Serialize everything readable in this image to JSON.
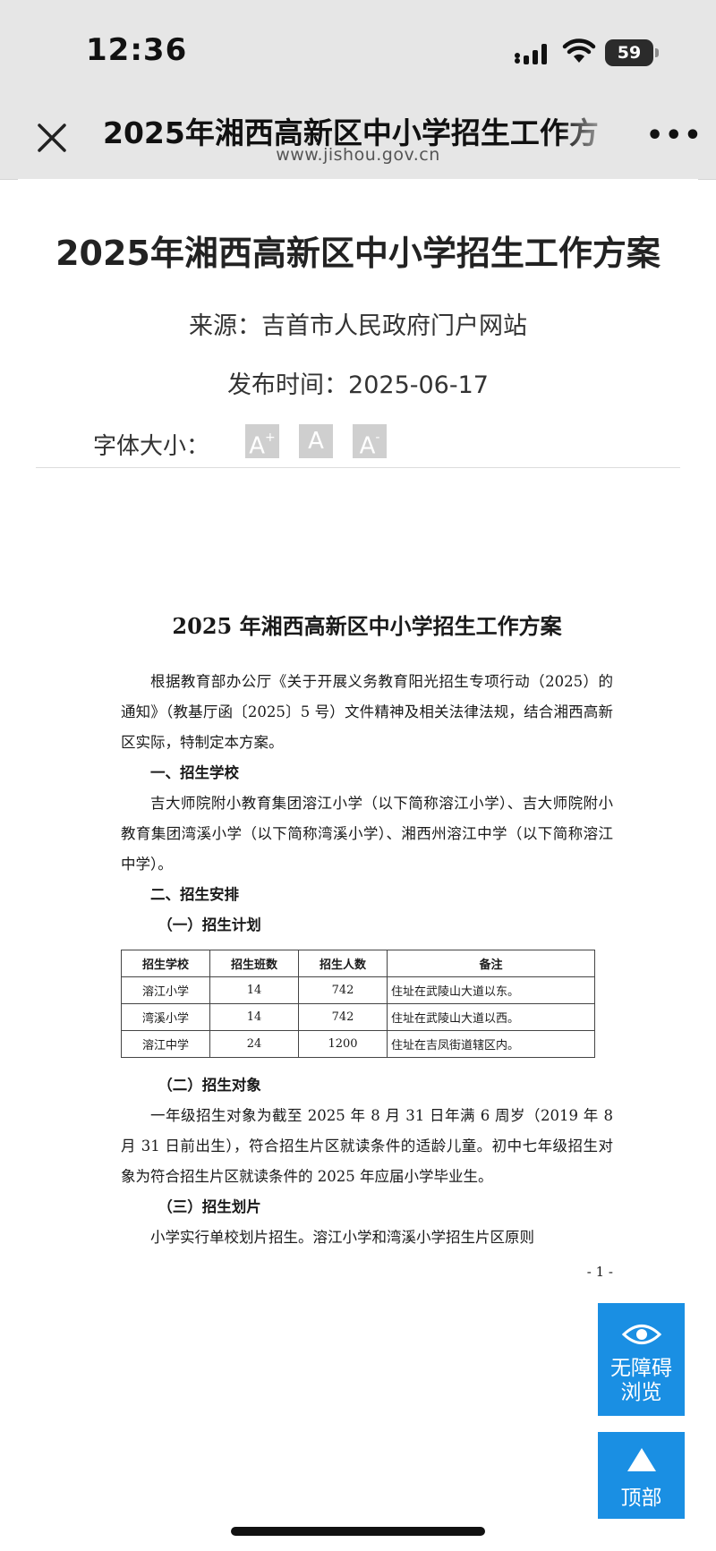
{
  "status_bar": {
    "time": "12:36",
    "battery": "59"
  },
  "nav": {
    "title": "2025年湘西高新区中小学招生工作方",
    "domain": "www.jishou.gov.cn"
  },
  "article": {
    "title": "2025年湘西高新区中小学招生工作方案",
    "source": "来源：吉首市人民政府门户网站",
    "date": "发布时间：2025-06-17",
    "font_size_label": "字体大小：",
    "font_buttons": {
      "larger": "A",
      "larger_sup": "+",
      "normal": "A",
      "smaller": "A",
      "smaller_sup": "-"
    }
  },
  "doc": {
    "title": "2025 年湘西高新区中小学招生工作方案",
    "intro": "根据教育部办公厅《关于开展义务教育阳光招生专项行动（2025）的通知》（教基厅函〔2025〕5 号）文件精神及相关法律法规，结合湘西高新区实际，特制定本方案。",
    "section1": "一、招生学校",
    "schools": "吉大师院附小教育集团溶江小学（以下简称溶江小学）、吉大师院附小教育集团湾溪小学（以下简称湾溪小学）、湘西州溶江中学（以下简称溶江中学）。",
    "section2": "二、招生安排",
    "sub1": "（一）招生计划",
    "table": {
      "headers": [
        "招生学校",
        "招生班数",
        "招生人数",
        "备注"
      ],
      "rows": [
        [
          "溶江小学",
          "14",
          "742",
          "住址在武陵山大道以东。"
        ],
        [
          "湾溪小学",
          "14",
          "742",
          "住址在武陵山大道以西。"
        ],
        [
          "溶江中学",
          "24",
          "1200",
          "住址在吉凤街道辖区内。"
        ]
      ]
    },
    "sub2": "（二）招生对象",
    "targets": "一年级招生对象为截至 2025 年 8 月 31 日年满 6 周岁（2019 年 8 月 31 日前出生），符合招生片区就读条件的适龄儿童。初中七年级招生对象为符合招生片区就读条件的 2025 年应届小学毕业生。",
    "sub3": "（三）招生划片",
    "zoning": "小学实行单校划片招生。溶江小学和湾溪小学招生片区原则",
    "page_number": "- 1 -"
  },
  "floating": {
    "a11y_line1": "无障碍",
    "a11y_line2": "浏览",
    "top": "顶部"
  }
}
